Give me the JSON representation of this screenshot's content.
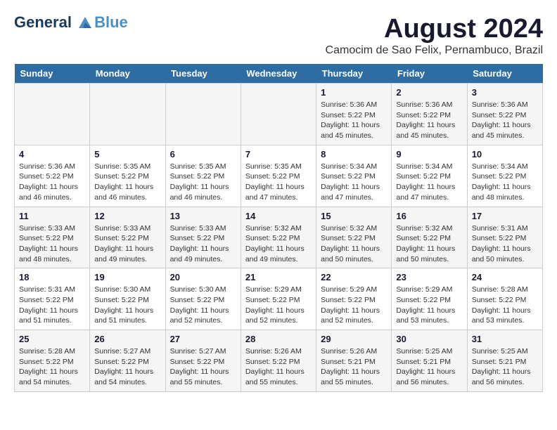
{
  "logo": {
    "line1": "General",
    "line2": "Blue"
  },
  "title": "August 2024",
  "subtitle": "Camocim de Sao Felix, Pernambuco, Brazil",
  "weekdays": [
    "Sunday",
    "Monday",
    "Tuesday",
    "Wednesday",
    "Thursday",
    "Friday",
    "Saturday"
  ],
  "weeks": [
    [
      {
        "day": "",
        "info": ""
      },
      {
        "day": "",
        "info": ""
      },
      {
        "day": "",
        "info": ""
      },
      {
        "day": "",
        "info": ""
      },
      {
        "day": "1",
        "info": "Sunrise: 5:36 AM\nSunset: 5:22 PM\nDaylight: 11 hours and 45 minutes."
      },
      {
        "day": "2",
        "info": "Sunrise: 5:36 AM\nSunset: 5:22 PM\nDaylight: 11 hours and 45 minutes."
      },
      {
        "day": "3",
        "info": "Sunrise: 5:36 AM\nSunset: 5:22 PM\nDaylight: 11 hours and 45 minutes."
      }
    ],
    [
      {
        "day": "4",
        "info": "Sunrise: 5:36 AM\nSunset: 5:22 PM\nDaylight: 11 hours and 46 minutes."
      },
      {
        "day": "5",
        "info": "Sunrise: 5:35 AM\nSunset: 5:22 PM\nDaylight: 11 hours and 46 minutes."
      },
      {
        "day": "6",
        "info": "Sunrise: 5:35 AM\nSunset: 5:22 PM\nDaylight: 11 hours and 46 minutes."
      },
      {
        "day": "7",
        "info": "Sunrise: 5:35 AM\nSunset: 5:22 PM\nDaylight: 11 hours and 47 minutes."
      },
      {
        "day": "8",
        "info": "Sunrise: 5:34 AM\nSunset: 5:22 PM\nDaylight: 11 hours and 47 minutes."
      },
      {
        "day": "9",
        "info": "Sunrise: 5:34 AM\nSunset: 5:22 PM\nDaylight: 11 hours and 47 minutes."
      },
      {
        "day": "10",
        "info": "Sunrise: 5:34 AM\nSunset: 5:22 PM\nDaylight: 11 hours and 48 minutes."
      }
    ],
    [
      {
        "day": "11",
        "info": "Sunrise: 5:33 AM\nSunset: 5:22 PM\nDaylight: 11 hours and 48 minutes."
      },
      {
        "day": "12",
        "info": "Sunrise: 5:33 AM\nSunset: 5:22 PM\nDaylight: 11 hours and 49 minutes."
      },
      {
        "day": "13",
        "info": "Sunrise: 5:33 AM\nSunset: 5:22 PM\nDaylight: 11 hours and 49 minutes."
      },
      {
        "day": "14",
        "info": "Sunrise: 5:32 AM\nSunset: 5:22 PM\nDaylight: 11 hours and 49 minutes."
      },
      {
        "day": "15",
        "info": "Sunrise: 5:32 AM\nSunset: 5:22 PM\nDaylight: 11 hours and 50 minutes."
      },
      {
        "day": "16",
        "info": "Sunrise: 5:32 AM\nSunset: 5:22 PM\nDaylight: 11 hours and 50 minutes."
      },
      {
        "day": "17",
        "info": "Sunrise: 5:31 AM\nSunset: 5:22 PM\nDaylight: 11 hours and 50 minutes."
      }
    ],
    [
      {
        "day": "18",
        "info": "Sunrise: 5:31 AM\nSunset: 5:22 PM\nDaylight: 11 hours and 51 minutes."
      },
      {
        "day": "19",
        "info": "Sunrise: 5:30 AM\nSunset: 5:22 PM\nDaylight: 11 hours and 51 minutes."
      },
      {
        "day": "20",
        "info": "Sunrise: 5:30 AM\nSunset: 5:22 PM\nDaylight: 11 hours and 52 minutes."
      },
      {
        "day": "21",
        "info": "Sunrise: 5:29 AM\nSunset: 5:22 PM\nDaylight: 11 hours and 52 minutes."
      },
      {
        "day": "22",
        "info": "Sunrise: 5:29 AM\nSunset: 5:22 PM\nDaylight: 11 hours and 52 minutes."
      },
      {
        "day": "23",
        "info": "Sunrise: 5:29 AM\nSunset: 5:22 PM\nDaylight: 11 hours and 53 minutes."
      },
      {
        "day": "24",
        "info": "Sunrise: 5:28 AM\nSunset: 5:22 PM\nDaylight: 11 hours and 53 minutes."
      }
    ],
    [
      {
        "day": "25",
        "info": "Sunrise: 5:28 AM\nSunset: 5:22 PM\nDaylight: 11 hours and 54 minutes."
      },
      {
        "day": "26",
        "info": "Sunrise: 5:27 AM\nSunset: 5:22 PM\nDaylight: 11 hours and 54 minutes."
      },
      {
        "day": "27",
        "info": "Sunrise: 5:27 AM\nSunset: 5:22 PM\nDaylight: 11 hours and 55 minutes."
      },
      {
        "day": "28",
        "info": "Sunrise: 5:26 AM\nSunset: 5:22 PM\nDaylight: 11 hours and 55 minutes."
      },
      {
        "day": "29",
        "info": "Sunrise: 5:26 AM\nSunset: 5:21 PM\nDaylight: 11 hours and 55 minutes."
      },
      {
        "day": "30",
        "info": "Sunrise: 5:25 AM\nSunset: 5:21 PM\nDaylight: 11 hours and 56 minutes."
      },
      {
        "day": "31",
        "info": "Sunrise: 5:25 AM\nSunset: 5:21 PM\nDaylight: 11 hours and 56 minutes."
      }
    ]
  ]
}
